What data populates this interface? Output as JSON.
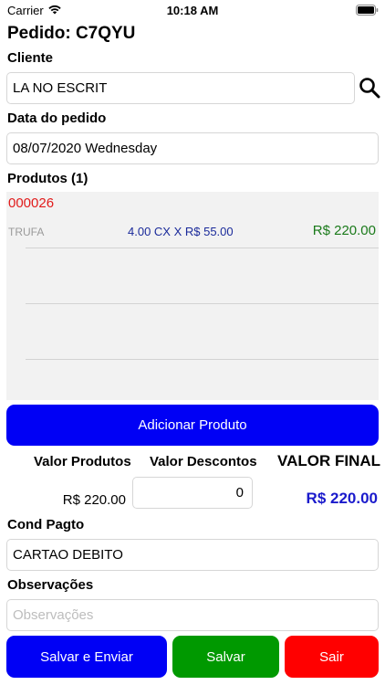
{
  "status": {
    "carrier": "Carrier",
    "time": "10:18 AM"
  },
  "title": "Pedido: C7QYU",
  "cliente": {
    "label": "Cliente",
    "value": "LA NO ESCRIT"
  },
  "data_pedido": {
    "label": "Data do pedido",
    "value": "08/07/2020 Wednesday"
  },
  "produtos": {
    "label": "Produtos (1)",
    "items": [
      {
        "code": "000026",
        "name": "TRUFA",
        "qty": "4.00 CX X R$ 55.00",
        "total": "R$ 220.00"
      }
    ]
  },
  "add_button": "Adicionar Produto",
  "summary": {
    "valor_produtos_label": "Valor Produtos",
    "valor_descontos_label": "Valor Descontos",
    "valor_final_label": "VALOR FINAL",
    "valor_produtos": "R$ 220.00",
    "desconto": "0",
    "valor_final": "R$ 220.00"
  },
  "cond_pagto": {
    "label": "Cond Pagto",
    "value": "CARTAO DEBITO"
  },
  "observacoes": {
    "label": "Observações",
    "placeholder": "Observações"
  },
  "buttons": {
    "salvar_enviar": "Salvar e Enviar",
    "salvar": "Salvar",
    "sair": "Sair"
  },
  "colors": {
    "primary": "#0000f5",
    "save": "#009900",
    "exit": "#ff0000",
    "final_value": "#1a1acc"
  }
}
